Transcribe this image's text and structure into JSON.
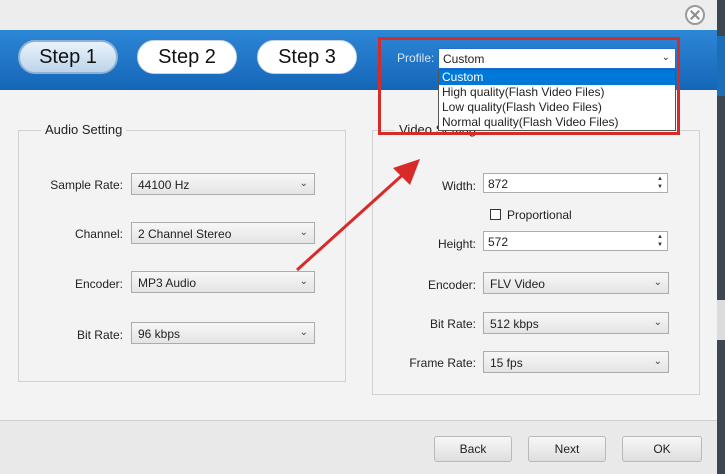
{
  "steps": [
    {
      "label": "Step 1",
      "active": true
    },
    {
      "label": "Step 2",
      "active": false
    },
    {
      "label": "Step 3",
      "active": false
    }
  ],
  "profile": {
    "label": "Profile:",
    "selected": "Custom",
    "options": [
      "Custom",
      "High quality(Flash Video Files)",
      "Low quality(Flash Video Files)",
      "Normal quality(Flash Video Files)"
    ]
  },
  "audio": {
    "title": "Audio Setting",
    "sample_rate": {
      "label": "Sample Rate:",
      "value": "44100 Hz"
    },
    "channel": {
      "label": "Channel:",
      "value": "2 Channel Stereo"
    },
    "encoder": {
      "label": "Encoder:",
      "value": "MP3 Audio"
    },
    "bit_rate": {
      "label": "Bit Rate:",
      "value": "96 kbps"
    }
  },
  "video": {
    "title": "Video Setting",
    "width": {
      "label": "Width:",
      "value": "872"
    },
    "proportional": {
      "label": "Proportional",
      "checked": false
    },
    "height": {
      "label": "Height:",
      "value": "572"
    },
    "encoder": {
      "label": "Encoder:",
      "value": "FLV Video"
    },
    "bit_rate": {
      "label": "Bit Rate:",
      "value": "512 kbps"
    },
    "frame_rate": {
      "label": "Frame Rate:",
      "value": "15 fps"
    }
  },
  "footer": {
    "back": "Back",
    "next": "Next",
    "ok": "OK"
  },
  "colors": {
    "header_blue": "#1f76c9",
    "annotation_red": "#d92a2a",
    "selection_blue": "#0078d7"
  }
}
